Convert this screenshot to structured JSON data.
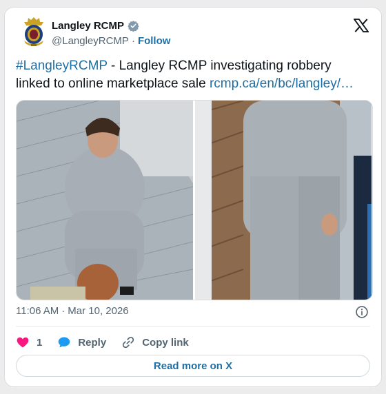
{
  "author": {
    "name": "Langley RCMP",
    "handle": "@LangleyRCMP",
    "separator": "·",
    "follow_label": "Follow"
  },
  "tweet": {
    "hashtag": "#LangleyRCMP",
    "text_line1": " - Langley RCMP investigating robbery",
    "text_line2": "linked to online marketplace sale ",
    "link": "rcmp.ca/en/bc/langley/…"
  },
  "meta": {
    "time": "11:06 AM",
    "separator": "·",
    "date": "Mar 10, 2026"
  },
  "actions": {
    "like_count": "1",
    "reply_label": "Reply",
    "copy_link_label": "Copy link"
  },
  "read_more_label": "Read more on X",
  "colors": {
    "link": "#1d6fa5",
    "heart": "#f91880",
    "reply_bubble": "#1d9bf0",
    "muted": "#536471"
  },
  "icons": [
    "rcmp-crest-icon",
    "verified-badge-icon",
    "x-logo-icon",
    "info-icon",
    "heart-icon",
    "reply-icon",
    "link-icon"
  ]
}
